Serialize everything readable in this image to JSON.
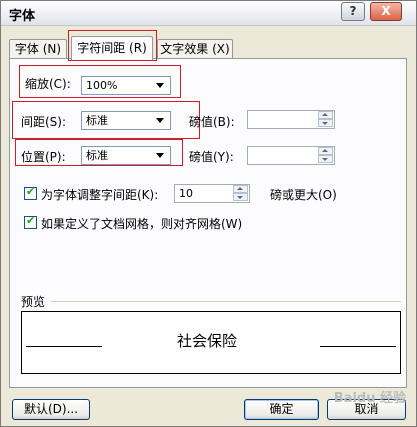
{
  "window": {
    "title": "字体",
    "help_label": "?",
    "close_label": "X"
  },
  "tabs": [
    {
      "label": "字体 (N)"
    },
    {
      "label": "字符间距 (R)"
    },
    {
      "label": "文字效果 (X)"
    }
  ],
  "fields": {
    "scale": {
      "label": "缩放(C):",
      "value": "100%"
    },
    "spacing": {
      "label": "间距(S):",
      "value": "标准",
      "by_label": "磅值(B):",
      "by_value": ""
    },
    "position": {
      "label": "位置(P):",
      "value": "标准",
      "by_label": "磅值(Y):",
      "by_value": ""
    }
  },
  "kerning": {
    "label": "为字体调整字间距(K):",
    "checked": true,
    "value": "10",
    "suffix": "磅或更大(O)"
  },
  "grid_snap": {
    "label": "如果定义了文档网格，则对齐网格(W)",
    "checked": true
  },
  "preview": {
    "group_label": "预览",
    "sample_text": "社会保险"
  },
  "buttons": {
    "default_label": "默认(D)...",
    "ok_label": "确定",
    "cancel_label": "取消"
  },
  "watermark": "Baidu 经验"
}
